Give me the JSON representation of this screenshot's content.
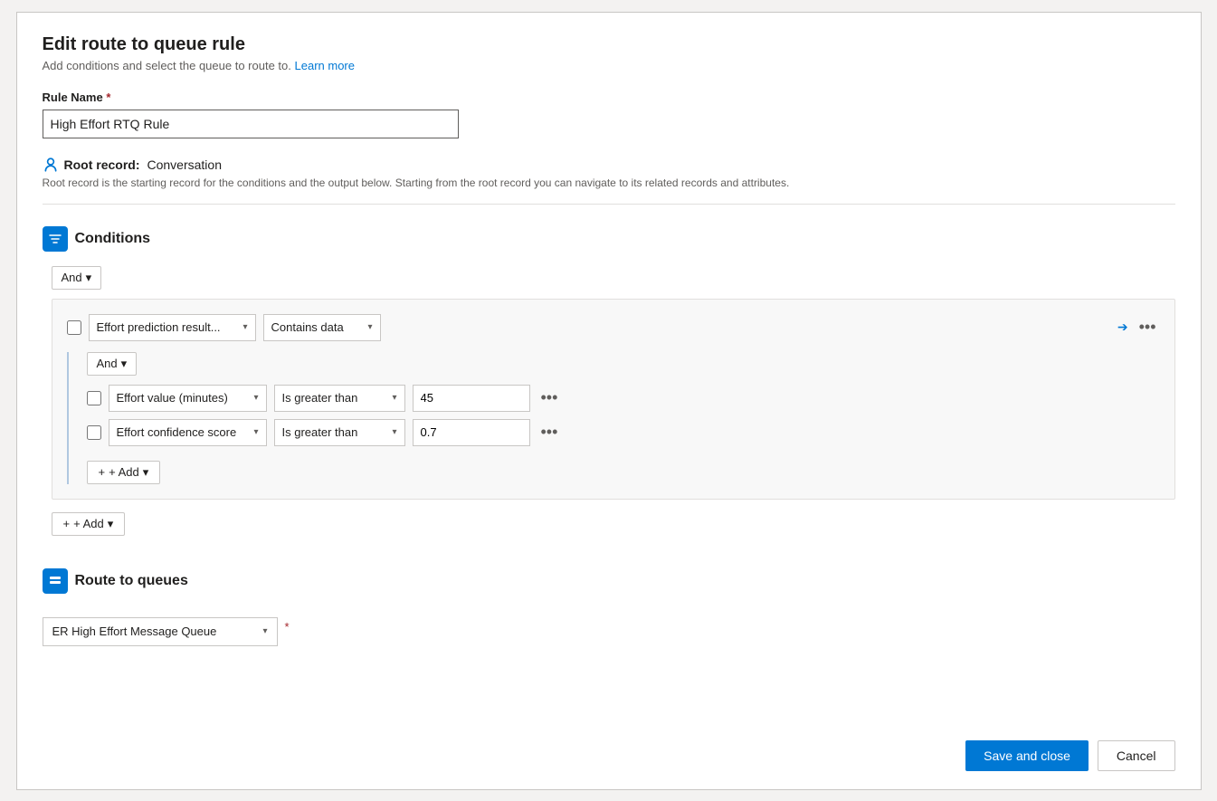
{
  "modal": {
    "title": "Edit route to queue rule",
    "subtitle": "Add conditions and select the queue to route to.",
    "learn_more": "Learn more"
  },
  "rule_name": {
    "label": "Rule Name",
    "required_marker": "*",
    "value": "High Effort RTQ Rule"
  },
  "root_record": {
    "label": "Root record:",
    "value": "Conversation",
    "description": "Root record is the starting record for the conditions and the output below. Starting from the root record you can navigate to its related records and attributes."
  },
  "conditions": {
    "section_title": "Conditions",
    "and_label": "And",
    "outer_add_label": "+ Add",
    "inner_add_label": "+ Add",
    "condition_block": {
      "field1_value": "Effort prediction result...",
      "operator1_value": "Contains data",
      "inner_and_label": "And",
      "row1": {
        "field": "Effort value (minutes)",
        "operator": "Is greater than",
        "value": "45"
      },
      "row2": {
        "field": "Effort confidence score",
        "operator": "Is greater than",
        "value": "0.7"
      }
    }
  },
  "route_queues": {
    "section_title": "Route to queues",
    "queue_value": "ER High Effort Message Queue"
  },
  "footer": {
    "save_label": "Save and close",
    "cancel_label": "Cancel"
  },
  "icons": {
    "chevron_down": "▾",
    "plus": "+",
    "expand": "⤢",
    "more": "⋯",
    "root_icon": "⚙",
    "section_icon": "⚡"
  }
}
